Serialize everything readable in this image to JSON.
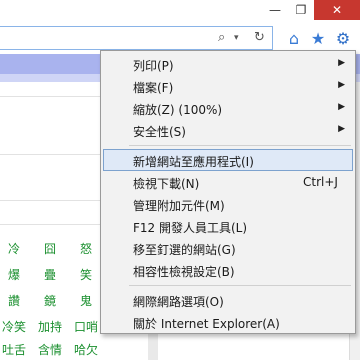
{
  "window": {
    "minimize_icon": "minimize-icon",
    "restore_icon": "restore-icon",
    "close_icon": "close-icon",
    "min_glyph": "—",
    "max_glyph": "❐",
    "close_glyph": "✕"
  },
  "toolbar": {
    "search_glyph": "⌕",
    "dropdown_glyph": "▾",
    "refresh_glyph": "↻",
    "home_glyph": "⌂",
    "fav_glyph": "★",
    "gear_glyph": "⚙"
  },
  "menu": {
    "items": [
      {
        "label": "列印(P)",
        "has_submenu": true
      },
      {
        "label": "檔案(F)",
        "has_submenu": true
      },
      {
        "label": "縮放(Z) (100%)",
        "has_submenu": true
      },
      {
        "label": "安全性(S)",
        "has_submenu": true
      },
      {
        "label": "新增網站至應用程式(I)",
        "highlighted": true
      },
      {
        "label": "檢視下載(N)",
        "shortcut": "Ctrl+J"
      },
      {
        "label": "管理附加元件(M)"
      },
      {
        "label": "F12 開發人員工具(L)"
      },
      {
        "label": "移至釘選的網站(G)"
      },
      {
        "label": "相容性檢視設定(B)"
      },
      {
        "label": "網際網路選項(O)"
      },
      {
        "label": "關於 Internet Explorer(A)"
      }
    ],
    "arrow_glyph": "▶"
  },
  "page": {
    "cells": [
      [
        "冷",
        "囧",
        "怒"
      ],
      [
        "爆",
        "疊",
        "笑"
      ],
      [
        "讚",
        "鏡",
        "鬼"
      ],
      [
        "冷笑",
        "加持",
        "口哨"
      ],
      [
        "吐舌",
        "含情",
        "哈欠"
      ]
    ]
  },
  "colors": {
    "stripe": "#a9b3ee",
    "close": "#c7372f",
    "highlight": "#dfe9f7",
    "text_green": "#1a8f2e"
  }
}
